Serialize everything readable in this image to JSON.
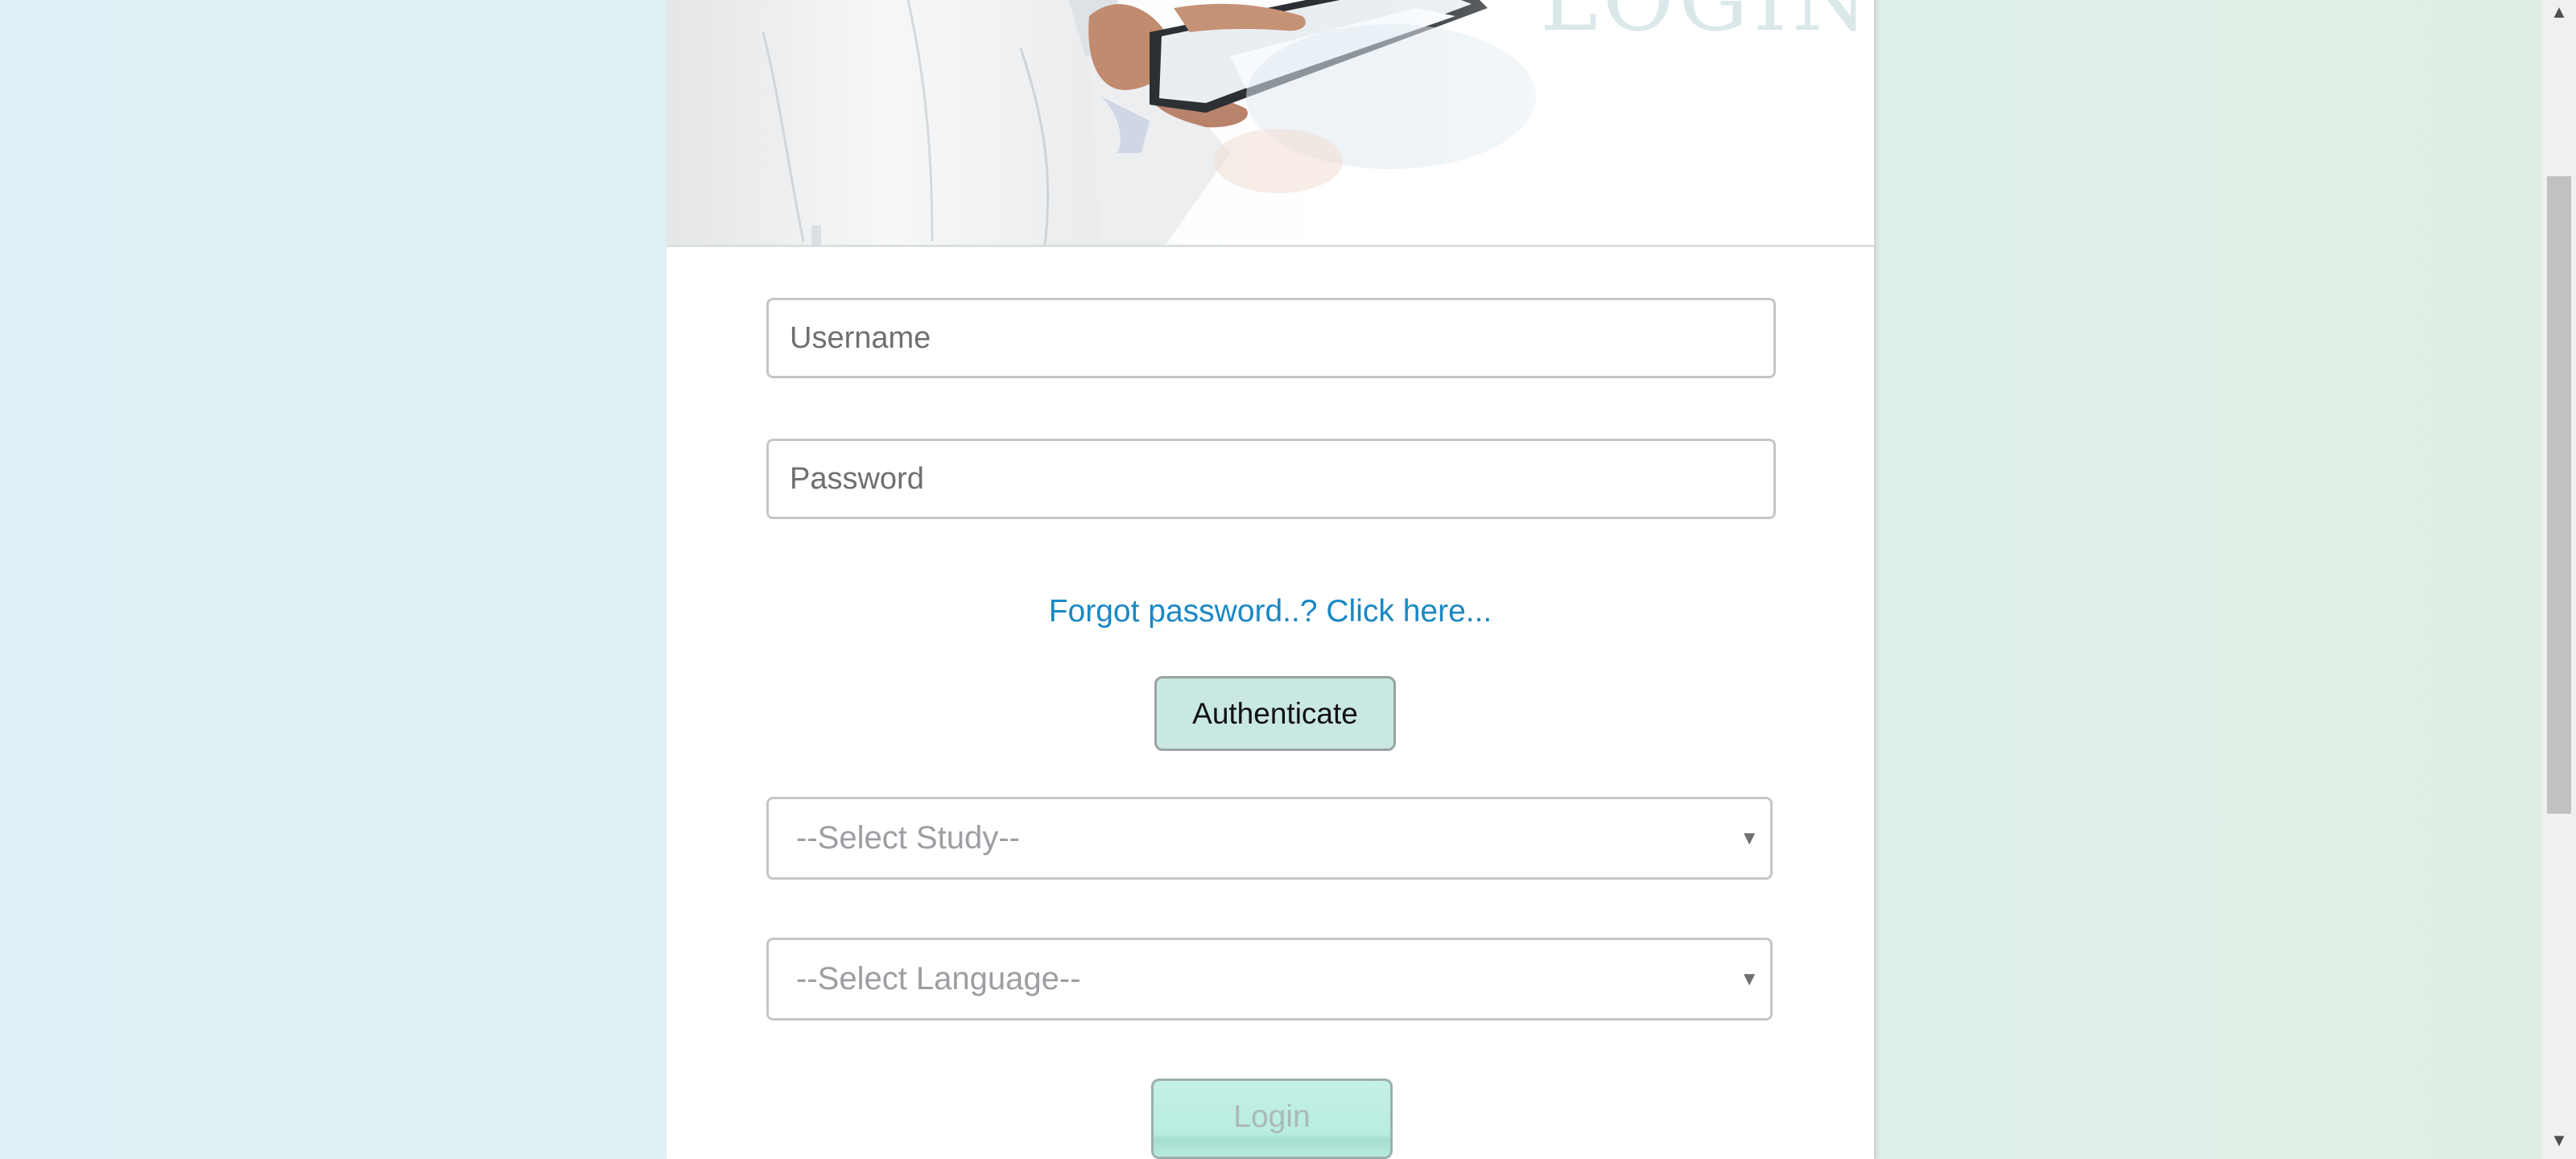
{
  "banner": {
    "title_watermark": "LOGIN"
  },
  "form": {
    "username_placeholder": "Username",
    "password_placeholder": "Password",
    "forgot_link": "Forgot password..? Click here...",
    "authenticate_label": "Authenticate",
    "study_select": "--Select Study--",
    "language_select": "--Select Language--",
    "login_label": "Login"
  },
  "scrollbar": {
    "up_icon": "▲",
    "down_icon": "▼",
    "thumb_position_fraction": 0.32
  },
  "colors": {
    "link": "#1a88c4",
    "authenticate_bg": "#c9e8e4",
    "login_bg": "#b9ede0"
  }
}
